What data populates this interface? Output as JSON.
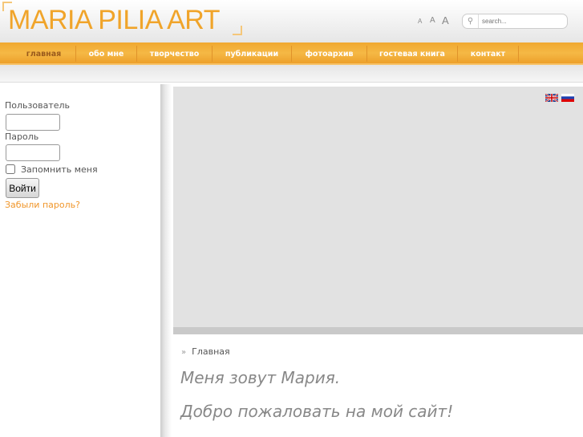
{
  "header": {
    "logo": "MARIA PILIA ART",
    "font_sizes": [
      "A",
      "A",
      "A"
    ],
    "search_placeholder": "search..."
  },
  "nav": [
    {
      "label": "главная",
      "active": true
    },
    {
      "label": "обо мне"
    },
    {
      "label": "творчество"
    },
    {
      "label": "публикации"
    },
    {
      "label": "фотоархив"
    },
    {
      "label": "гостевая книга"
    },
    {
      "label": "контакт"
    }
  ],
  "login": {
    "username_label": "Пользователь",
    "password_label": "Пароль",
    "remember_label": "Запомнить меня",
    "submit": "Войти",
    "forgot": "Забыли пароль?"
  },
  "content": {
    "breadcrumb_sep": "»",
    "breadcrumb": "Главная",
    "line1": "Меня зовут Мария.",
    "line2": "Добро пожаловать на мой сайт!"
  },
  "colors": {
    "accent": "#f0a42a",
    "link": "#f0962a"
  }
}
